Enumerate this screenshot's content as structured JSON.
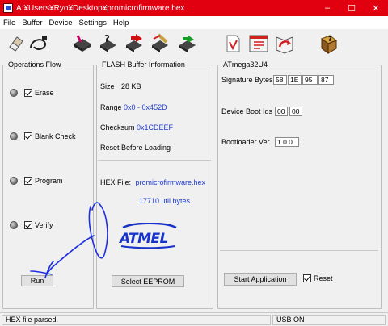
{
  "window": {
    "title": "A:¥Users¥Ryo¥Desktop¥promicrofirmware.hex",
    "minimize": "–",
    "maximize": "☐",
    "close": "✕"
  },
  "menu": [
    "File",
    "Buffer",
    "Device",
    "Settings",
    "Help"
  ],
  "toolbar": {
    "buttons": [
      "eraser-icon",
      "usb-cable-icon",
      "memory-chip-icon",
      "question-chip-icon",
      "chip-arrow-icon",
      "chip-edit-icon",
      "chip-check-icon",
      "open-file-icon",
      "book-icon",
      "book-arrow-icon",
      "help-book-icon"
    ]
  },
  "operations": {
    "title": "Operations Flow",
    "steps": [
      "Erase",
      "Blank Check",
      "Program",
      "Verify"
    ],
    "run_label": "Run"
  },
  "flash": {
    "title": "FLASH Buffer Information",
    "size_label": "Size",
    "size_value": "28 KB",
    "range_label": "Range",
    "range_value": "0x0 - 0x452D",
    "checksum_label": "Checksum",
    "checksum_value": "0x1CDEEF",
    "reset_label": "Reset Before Loading",
    "hex_label": "HEX File:",
    "hex_file": "promicrofirmware.hex",
    "bytes": "17710 util bytes",
    "logo_text": "ATMEL",
    "select_eeprom": "Select EEPROM"
  },
  "device": {
    "title": "ATmega32U4",
    "signature_label": "Signature Bytes",
    "signature_bytes": [
      "58",
      "1E",
      "95",
      "87"
    ],
    "boot_ids_label": "Device Boot Ids",
    "boot_ids": [
      "00",
      "00"
    ],
    "bootloader_label": "Bootloader Ver.",
    "bootloader_value": "1.0.0",
    "start_app_label": "Start Application",
    "reset_label": "Reset"
  },
  "status": {
    "left": "HEX file parsed.",
    "right": "USB ON"
  }
}
